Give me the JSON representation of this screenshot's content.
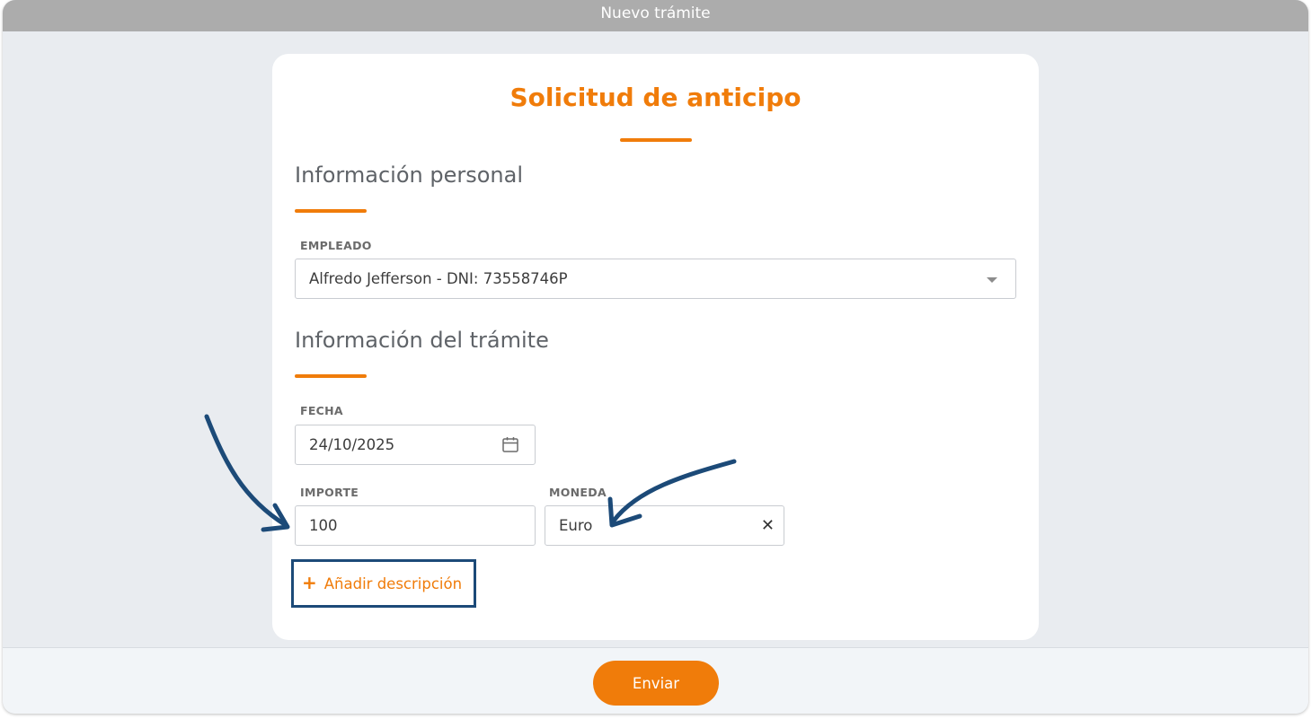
{
  "window": {
    "title": "Nuevo trámite"
  },
  "form": {
    "title": "Solicitud de anticipo",
    "sections": {
      "personal": {
        "title": "Información personal"
      },
      "tramite": {
        "title": "Información del trámite"
      }
    },
    "empleado": {
      "label": "EMPLEADO",
      "value": "Alfredo Jefferson - DNI: 73558746P",
      "icon": "chevron-down-icon"
    },
    "fecha": {
      "label": "FECHA",
      "value": "24/10/2025",
      "icon": "calendar-icon"
    },
    "importe": {
      "label": "IMPORTE",
      "value": "100"
    },
    "moneda": {
      "label": "MONEDA",
      "value": "Euro",
      "clear_symbol": "✕"
    },
    "add_description": {
      "plus": "+",
      "label": "Añadir descripción"
    }
  },
  "footer": {
    "send_label": "Enviar"
  },
  "colors": {
    "accent": "#f07c0a",
    "annotation": "#1c4a78",
    "titlebar": "#acacac"
  }
}
